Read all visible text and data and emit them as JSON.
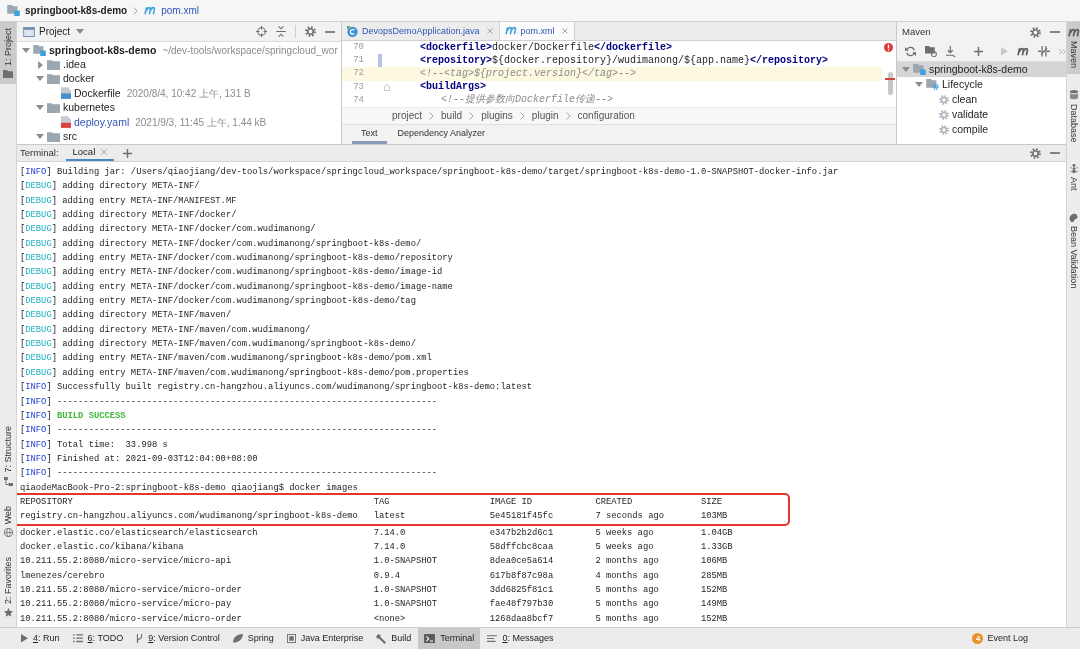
{
  "breadcrumb": [
    {
      "kind": "module",
      "label": "springboot-k8s-demo",
      "modified": false
    },
    {
      "kind": "maven",
      "label": "pom.xml",
      "modified": true
    }
  ],
  "left_strip": {
    "top": [
      {
        "kind": "project",
        "label": "1: Project",
        "selected": true
      }
    ],
    "bottom": [
      {
        "kind": "structure",
        "label": "7: Structure",
        "selected": false
      },
      {
        "kind": "web",
        "label": "Web",
        "selected": false
      },
      {
        "kind": "favorites",
        "label": "2: Favorites",
        "selected": false
      }
    ]
  },
  "project_panel": {
    "title": "Project",
    "tree": [
      {
        "kind": "module",
        "name": "springboot-k8s-demo",
        "detail": "~/dev-tools/workspace/springcloud_wor",
        "expanded": true,
        "modified": false,
        "children": [
          {
            "kind": "folder",
            "name": ".idea",
            "expanded": false,
            "modified": false
          },
          {
            "kind": "folder",
            "name": "docker",
            "expanded": true,
            "modified": false,
            "children": [
              {
                "kind": "dockerfile",
                "name": "Dockerfile",
                "detail": "2020/8/4, 10:42 上午, 131 B",
                "modified": false
              }
            ]
          },
          {
            "kind": "folder",
            "name": "kubernetes",
            "expanded": true,
            "modified": false,
            "children": [
              {
                "kind": "yaml",
                "name": "deploy.yaml",
                "detail": "2021/9/3, 11:45 上午, 1.44 kB",
                "modified": true
              }
            ]
          },
          {
            "kind": "folder",
            "name": "src",
            "expanded": true,
            "modified": false
          }
        ]
      }
    ]
  },
  "editor": {
    "tabs": [
      {
        "kind": "java",
        "label": "DevopsDemoApplication.java",
        "selected": false,
        "modified": true
      },
      {
        "kind": "maven",
        "label": "pom.xml",
        "selected": true,
        "modified": true
      }
    ],
    "has_errors": true,
    "lines": [
      {
        "number": "70",
        "kind": "code",
        "text": "**<dockerfile>**docker/Dockerfile**</dockerfile>**",
        "current": false,
        "changed": false,
        "foldable": false
      },
      {
        "number": "71",
        "kind": "code",
        "text": "**<repository>**${docker.repository}/wudimanong/${app.name}**</repository>**",
        "current": false,
        "changed": true,
        "foldable": false
      },
      {
        "number": "72",
        "kind": "comment",
        "text": "<!--<tag>${project.version}</tag>-->",
        "current": true,
        "changed": false,
        "foldable": false
      },
      {
        "number": "73",
        "kind": "code",
        "text": "**<buildArgs>**",
        "current": false,
        "changed": false,
        "foldable": true,
        "children": [
          {
            "number": "74",
            "kind": "comment",
            "text": "<!--提供参数向Dockerfile传递-->",
            "current": false,
            "changed": false,
            "foldable": false
          }
        ]
      }
    ],
    "breadcrumb": [
      "project",
      "build",
      "plugins",
      "plugin",
      "configuration"
    ],
    "views": [
      {
        "label": "Text",
        "selected": true
      },
      {
        "label": "Dependency Analyzer",
        "selected": false
      }
    ]
  },
  "maven_panel": {
    "title": "Maven",
    "toolbar": [
      [
        {
          "kind": "reload",
          "disabled": false
        },
        {
          "kind": "folder_sync",
          "disabled": false
        },
        {
          "kind": "download",
          "disabled": false
        }
      ],
      [
        {
          "kind": "add",
          "disabled": false
        }
      ],
      [
        {
          "kind": "run",
          "disabled": true
        },
        {
          "kind": "execute",
          "disabled": false
        },
        {
          "kind": "skip_tests",
          "disabled": false
        }
      ]
    ],
    "tree": [
      {
        "kind": "module",
        "name": "springboot-k8s-demo",
        "selected": true,
        "expanded": true,
        "children": [
          {
            "kind": "lifecycle",
            "name": "Lifecycle",
            "selected": false,
            "expanded": true,
            "children": [
              {
                "kind": "goal",
                "name": "clean",
                "selected": false
              },
              {
                "kind": "goal",
                "name": "validate",
                "selected": false
              },
              {
                "kind": "goal",
                "name": "compile",
                "selected": false
              }
            ]
          }
        ]
      }
    ]
  },
  "right_strip": [
    {
      "kind": "maven",
      "label": "Maven",
      "selected": true
    },
    {
      "kind": "database",
      "label": "Database",
      "selected": false
    },
    {
      "kind": "ant",
      "label": "Ant",
      "selected": false
    },
    {
      "kind": "bean",
      "label": "Bean Validation",
      "selected": false
    }
  ],
  "terminal": {
    "title": "Terminal:",
    "tabs": [
      {
        "label": "Local",
        "selected": true
      }
    ],
    "lines": [
      {
        "kind": "info",
        "tag": [
          "[",
          "INFO",
          "]"
        ],
        "text": "Building jar: /Users/qiaojiang/dev-tools/workspace/springcloud_workspace/springboot-k8s-demo/target/springboot-k8s-demo-1.0-SNAPSHOT-docker-info.jar"
      },
      {
        "kind": "debug",
        "tag": [
          "[",
          "DEBUG",
          "]"
        ],
        "text": "adding directory META-INF/"
      },
      {
        "kind": "debug",
        "tag": [
          "[",
          "DEBUG",
          "]"
        ],
        "text": "adding entry META-INF/MANIFEST.MF"
      },
      {
        "kind": "debug",
        "tag": [
          "[",
          "DEBUG",
          "]"
        ],
        "text": "adding directory META-INF/docker/"
      },
      {
        "kind": "debug",
        "tag": [
          "[",
          "DEBUG",
          "]"
        ],
        "text": "adding directory META-INF/docker/com.wudimanong/"
      },
      {
        "kind": "debug",
        "tag": [
          "[",
          "DEBUG",
          "]"
        ],
        "text": "adding directory META-INF/docker/com.wudimanong/springboot-k8s-demo/"
      },
      {
        "kind": "debug",
        "tag": [
          "[",
          "DEBUG",
          "]"
        ],
        "text": "adding entry META-INF/docker/com.wudimanong/springboot-k8s-demo/repository"
      },
      {
        "kind": "debug",
        "tag": [
          "[",
          "DEBUG",
          "]"
        ],
        "text": "adding entry META-INF/docker/com.wudimanong/springboot-k8s-demo/image-id"
      },
      {
        "kind": "debug",
        "tag": [
          "[",
          "DEBUG",
          "]"
        ],
        "text": "adding entry META-INF/docker/com.wudimanong/springboot-k8s-demo/image-name"
      },
      {
        "kind": "debug",
        "tag": [
          "[",
          "DEBUG",
          "]"
        ],
        "text": "adding entry META-INF/docker/com.wudimanong/springboot-k8s-demo/tag"
      },
      {
        "kind": "debug",
        "tag": [
          "[",
          "DEBUG",
          "]"
        ],
        "text": "adding directory META-INF/maven/"
      },
      {
        "kind": "debug",
        "tag": [
          "[",
          "DEBUG",
          "]"
        ],
        "text": "adding directory META-INF/maven/com.wudimanong/"
      },
      {
        "kind": "debug",
        "tag": [
          "[",
          "DEBUG",
          "]"
        ],
        "text": "adding directory META-INF/maven/com.wudimanong/springboot-k8s-demo/"
      },
      {
        "kind": "debug",
        "tag": [
          "[",
          "DEBUG",
          "]"
        ],
        "text": "adding entry META-INF/maven/com.wudimanong/springboot-k8s-demo/pom.xml"
      },
      {
        "kind": "debug",
        "tag": [
          "[",
          "DEBUG",
          "]"
        ],
        "text": "adding entry META-INF/maven/com.wudimanong/springboot-k8s-demo/pom.properties"
      },
      {
        "kind": "info",
        "tag": [
          "[",
          "INFO",
          "]"
        ],
        "text": "Successfully built registry.cn-hangzhou.aliyuncs.com/wudimanong/springboot-k8s-demo:latest"
      },
      {
        "kind": "info",
        "tag": [
          "[",
          "INFO",
          "]"
        ],
        "text": "------------------------------------------------------------------------"
      },
      {
        "kind": "success",
        "tag": [
          "[",
          "INFO",
          "]"
        ],
        "text": "BUILD SUCCESS"
      },
      {
        "kind": "info",
        "tag": [
          "[",
          "INFO",
          "]"
        ],
        "text": "------------------------------------------------------------------------"
      },
      {
        "kind": "info",
        "tag": [
          "[",
          "INFO",
          "]"
        ],
        "text": "Total time:  33.998 s"
      },
      {
        "kind": "info",
        "tag": [
          "[",
          "INFO",
          "]"
        ],
        "text": "Finished at: 2021-09-03T12:04:00+08:00"
      },
      {
        "kind": "info",
        "tag": [
          "[",
          "INFO",
          "]"
        ],
        "text": "------------------------------------------------------------------------"
      },
      {
        "kind": "prompt",
        "text": "qiaodeMacBook-Pro-2:springboot-k8s-demo qiaojiang$ docker images"
      }
    ],
    "docker_images": {
      "columns": [
        "REPOSITORY",
        "TAG",
        "IMAGE ID",
        "CREATED",
        "SIZE"
      ],
      "header_highlighted": true,
      "rows": [
        {
          "cells": [
            "registry.cn-hangzhou.aliyuncs.com/wudimanong/springboot-k8s-demo",
            "latest",
            "5e45181f45fc",
            "7 seconds ago",
            "103MB"
          ],
          "highlighted": true
        },
        {
          "cells": [
            "docker.elastic.co/elasticsearch/elasticsearch",
            "7.14.0",
            "e347b2b2d6c1",
            "5 weeks ago",
            "1.04GB"
          ],
          "highlighted": false
        },
        {
          "cells": [
            "docker.elastic.co/kibana/kibana",
            "7.14.0",
            "58dffcbc8caa",
            "5 weeks ago",
            "1.33GB"
          ],
          "highlighted": false
        },
        {
          "cells": [
            "10.211.55.2:8080/micro-service/micro-api",
            "1.0-SNAPSHOT",
            "8dea0ce5a614",
            "2 months ago",
            "106MB"
          ],
          "highlighted": false
        },
        {
          "cells": [
            "lmenezes/cerebro",
            "0.9.4",
            "617b8f87c98a",
            "4 months ago",
            "285MB"
          ],
          "highlighted": false
        },
        {
          "cells": [
            "10.211.55.2:8080/micro-service/micro-order",
            "1.0-SNAPSHOT",
            "3dd6825f81c1",
            "5 months ago",
            "152MB"
          ],
          "highlighted": false
        },
        {
          "cells": [
            "10.211.55.2:8080/micro-service/micro-pay",
            "1.0-SNAPSHOT",
            "fae48f797b30",
            "5 months ago",
            "149MB"
          ],
          "highlighted": false
        },
        {
          "cells": [
            "10.211.55.2:8080/micro-service/micro-order",
            "<none>",
            "1268daa8bcf7",
            "5 months ago",
            "152MB"
          ],
          "highlighted": false
        }
      ]
    }
  },
  "bottom_bar": {
    "buttons": [
      {
        "kind": "run",
        "mnemonic": "4",
        "label": ": Run",
        "selected": false
      },
      {
        "kind": "todo",
        "mnemonic": "6",
        "label": ": TODO",
        "selected": false
      },
      {
        "kind": "vcs",
        "mnemonic": "9",
        "label": ": Version Control",
        "selected": false
      },
      {
        "kind": "spring",
        "label": "Spring",
        "selected": false
      },
      {
        "kind": "java_ee",
        "label": "Java Enterprise",
        "selected": false
      },
      {
        "kind": "build",
        "label": "Build",
        "selected": false
      },
      {
        "kind": "terminal",
        "label": "Terminal",
        "selected": true
      },
      {
        "kind": "messages",
        "mnemonic": "0",
        "label": ": Messages",
        "selected": false
      }
    ],
    "event_log": {
      "count": "4",
      "label": "Event Log"
    }
  }
}
